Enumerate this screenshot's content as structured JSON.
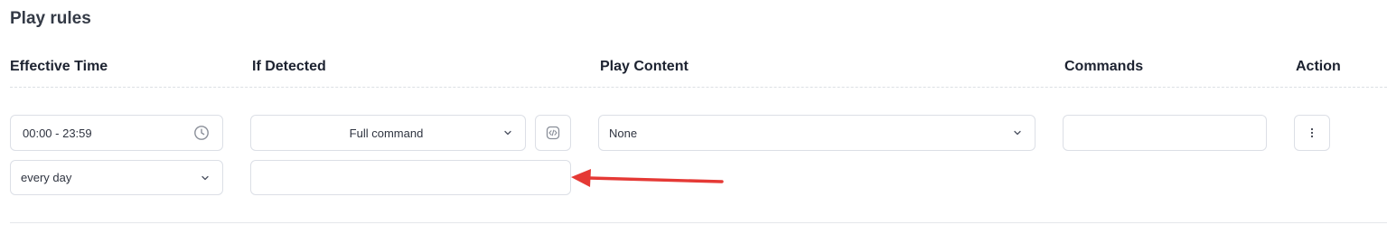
{
  "section": {
    "title": "Play rules"
  },
  "columns": {
    "effective_time": "Effective Time",
    "if_detected": "If Detected",
    "play_content": "Play Content",
    "commands": "Commands",
    "action": "Action"
  },
  "rule": {
    "time_range": "00:00 - 23:59",
    "repeat": "every day",
    "detect_mode": "Full command",
    "detect_text": "",
    "play_content": "None",
    "commands": ""
  },
  "icons": {
    "time": "clock-icon",
    "code": "code-icon",
    "more": "more-vertical-icon",
    "dropdown": "chevron-down-icon"
  },
  "colors": {
    "annotation_arrow": "#e53935"
  }
}
